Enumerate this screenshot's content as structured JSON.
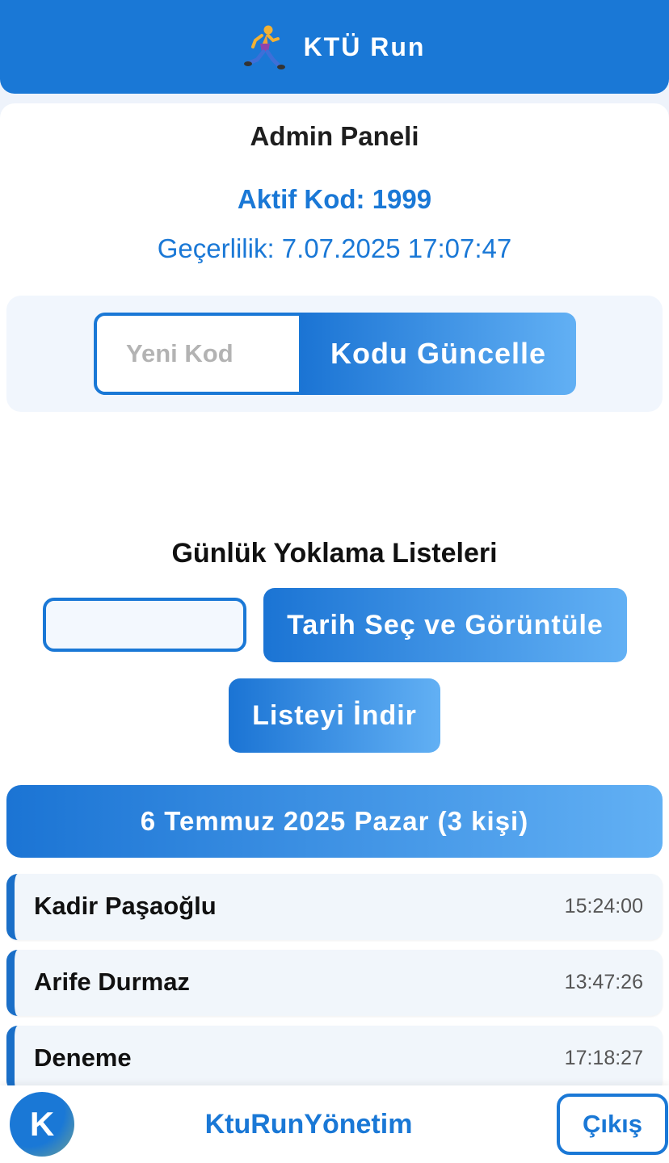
{
  "header": {
    "title": "KTÜ Run",
    "icon": "runner-icon"
  },
  "admin": {
    "title": "Admin Paneli",
    "active_code": "Aktif Kod: 1999",
    "validity": "Geçerlilik: 7.07.2025 17:07:47"
  },
  "code_form": {
    "input_placeholder": "Yeni Kod",
    "input_value": "",
    "button_label": "Kodu Güncelle"
  },
  "attendance": {
    "title": "Günlük Yoklama Listeleri",
    "date_value": "",
    "view_button": "Tarih Seç ve Görüntüle",
    "download_button": "Listeyi İndir",
    "day_label": "6 Temmuz 2025 Pazar (3 kişi)",
    "entries": [
      {
        "name": "Kadir Paşaoğlu",
        "time": "15:24:00"
      },
      {
        "name": "Arife Durmaz",
        "time": "13:47:26"
      },
      {
        "name": "Deneme",
        "time": "17:18:27"
      }
    ]
  },
  "footer": {
    "avatar_letter": "K",
    "title": "KtuRunYönetim",
    "logout_label": "Çıkış"
  },
  "colors": {
    "primary": "#1a78d6",
    "gradient_end": "#62b0f4",
    "background": "#eef3fb"
  }
}
